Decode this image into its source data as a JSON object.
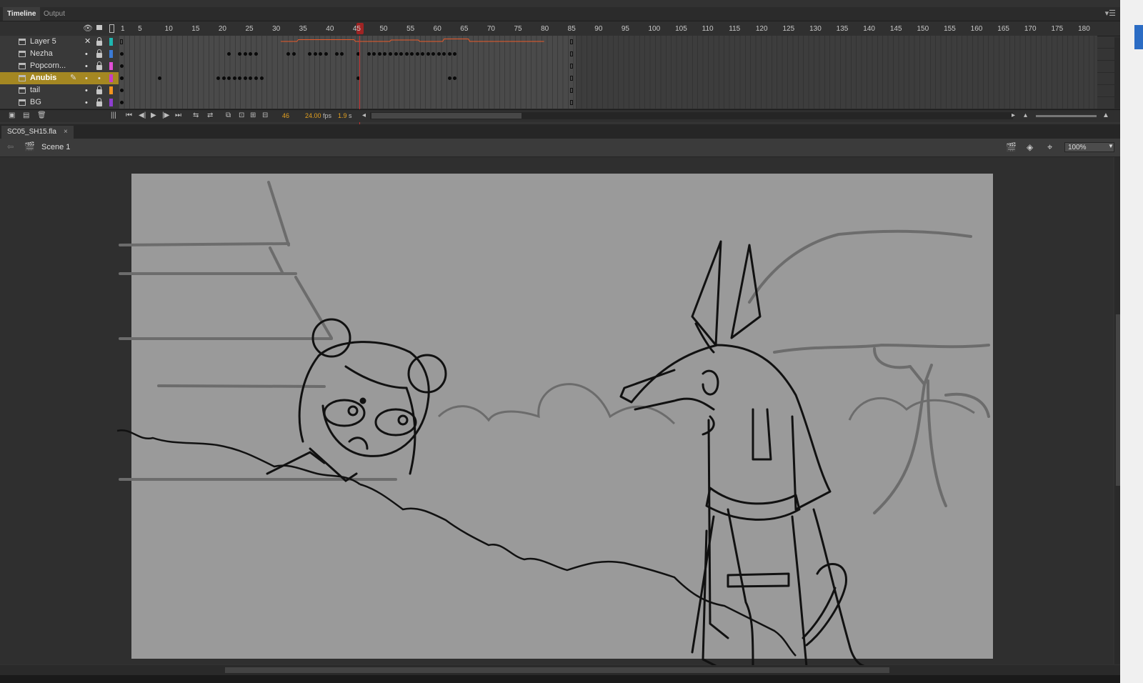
{
  "panel_tabs": {
    "timeline": "Timeline",
    "output": "Output"
  },
  "ruler": {
    "first": "1",
    "ticks": [
      "5",
      "10",
      "15",
      "20",
      "25",
      "30",
      "35",
      "40",
      "45",
      "50",
      "55",
      "60",
      "65",
      "70",
      "75",
      "80",
      "85",
      "90",
      "95",
      "100",
      "105",
      "110",
      "115",
      "120",
      "125",
      "130",
      "135",
      "140",
      "145",
      "150",
      "155",
      "160",
      "165",
      "170",
      "175",
      "180"
    ],
    "current_frame": "45"
  },
  "layers": [
    {
      "name": "Layer 5",
      "color": "#1fb6b0",
      "active": false
    },
    {
      "name": "Nezha",
      "color": "#3b7bd6",
      "active": false
    },
    {
      "name": "Popcorn...",
      "color": "#e14fd6",
      "active": false
    },
    {
      "name": "Anubis",
      "color": "#c63cc7",
      "active": true
    },
    {
      "name": "tail",
      "color": "#f2941f",
      "active": false
    },
    {
      "name": "BG",
      "color": "#8e3fd0",
      "active": false
    }
  ],
  "timeline_controls": {
    "current_frame": "46",
    "fps": "24.00",
    "fps_unit": "fps",
    "elapsed": "1.9",
    "elapsed_unit": "s"
  },
  "document": {
    "tab_name": "SC05_SH15.fla",
    "close": "×"
  },
  "edit_bar": {
    "scene": "Scene 1",
    "zoom": "100%"
  },
  "icons": [
    "eye-icon",
    "lock-icon",
    "outline-icon",
    "layer-icon",
    "pencil-icon",
    "new-layer-icon",
    "folder-icon",
    "trash-icon",
    "first-frame-icon",
    "step-back-icon",
    "play-icon",
    "step-forward-icon",
    "last-frame-icon",
    "loop-icon",
    "onion-skin-icon",
    "back-arrow-icon",
    "clapper-icon",
    "symbol-icon",
    "center-stage-icon",
    "panel-menu-icon"
  ],
  "colors": {
    "accent": "#a48722",
    "playhead": "#c83030",
    "fps_text": "#e3a01f",
    "stage": "#9a9a9a"
  }
}
